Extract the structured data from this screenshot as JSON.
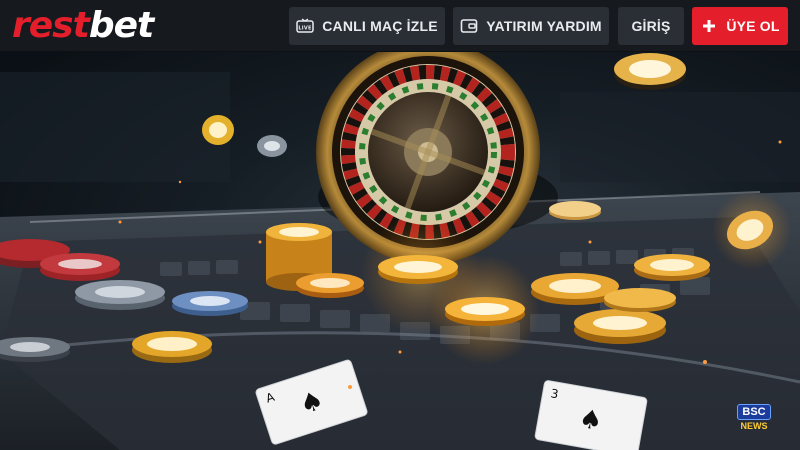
{
  "header": {
    "logo": {
      "part1": "rest",
      "part2": "bet"
    },
    "nav": [
      {
        "label": "CANLI MAÇ İZLE",
        "icon": "live-tv-icon"
      },
      {
        "label": "YATIRIM YARDIM",
        "icon": "wallet-icon"
      },
      {
        "label": "GİRİŞ"
      },
      {
        "label": "ÜYE OL",
        "icon": "plus-icon"
      }
    ]
  },
  "hero": {
    "image": "casino-roulette-chips-cards-illustration",
    "watermark": {
      "line1": "BSC",
      "line2": "NEWS"
    }
  },
  "colors": {
    "brand_red": "#e41e2b",
    "header_bg": "#161a1f",
    "button_bg": "#2a2f36"
  }
}
